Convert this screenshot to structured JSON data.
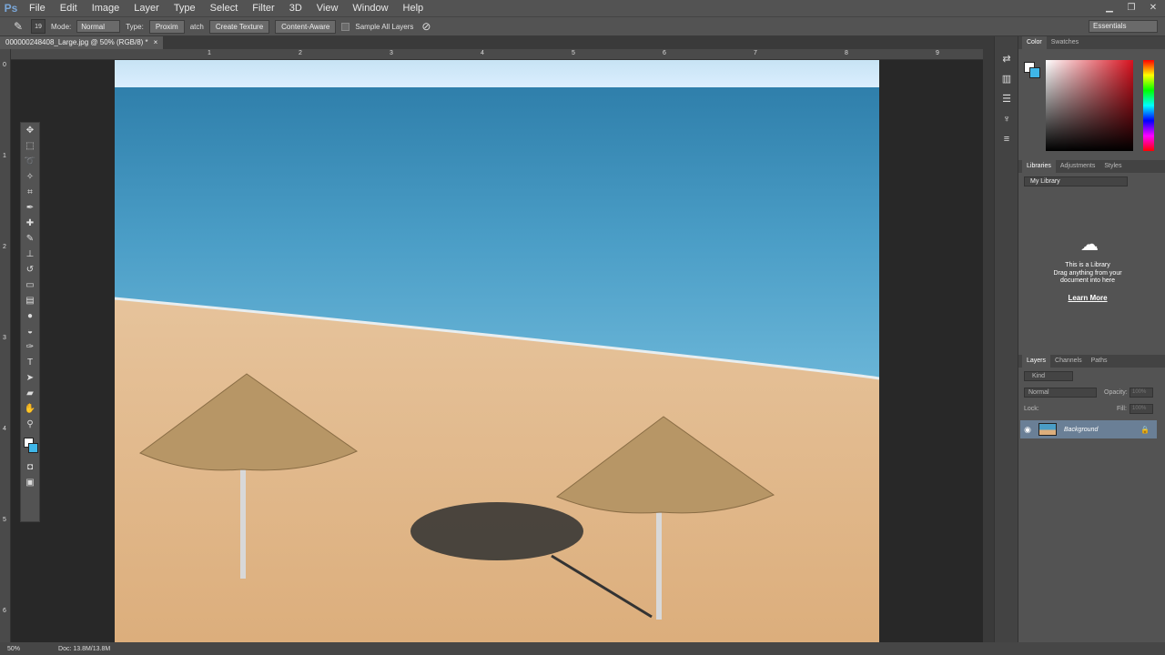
{
  "app": {
    "logo": "Ps"
  },
  "menu": [
    "File",
    "Edit",
    "Image",
    "Layer",
    "Type",
    "Select",
    "Filter",
    "3D",
    "View",
    "Window",
    "Help"
  ],
  "options": {
    "mode_label": "Mode:",
    "mode_value": "Normal",
    "type_label": "Type:",
    "proximity": "Proxim",
    "match": "atch",
    "create_texture": "Create Texture",
    "content_aware": "Content-Aware",
    "sample_all_layers": "Sample All Layers",
    "brush_size": "19"
  },
  "workspace": "Essentials",
  "document": {
    "tab_title": "000000248408_Large.jpg @ 50% (RGB/8) *",
    "close": "×"
  },
  "ruler_top": [
    "1",
    "2",
    "3",
    "4",
    "5",
    "6",
    "7",
    "8",
    "9"
  ],
  "ruler_left": [
    "0",
    "1",
    "2",
    "3",
    "4",
    "5",
    "6"
  ],
  "panels": {
    "color_tabs": [
      "Color",
      "Swatches"
    ],
    "library_tabs": [
      "Libraries",
      "Adjustments",
      "Styles"
    ],
    "library_select": "My Library",
    "library_title": "This is a Library",
    "library_desc1": "Drag anything from your",
    "library_desc2": "document into here",
    "learn_more": "Learn More",
    "layers_tabs": [
      "Layers",
      "Channels",
      "Paths"
    ],
    "kind": "Kind",
    "blend_mode": "Normal",
    "opacity_label": "Opacity:",
    "opacity_value": "100%",
    "lock_label": "Lock:",
    "fill_label": "Fill:",
    "fill_value": "100%",
    "layer_name": "Background"
  },
  "status": {
    "zoom": "50%",
    "doc": "Doc: 13.8M/13.8M"
  },
  "colors": {
    "accent": "#3fb6e8",
    "sky": "#cfe8f6",
    "sea": "#4b9fc4",
    "sand": "#e0b688"
  }
}
